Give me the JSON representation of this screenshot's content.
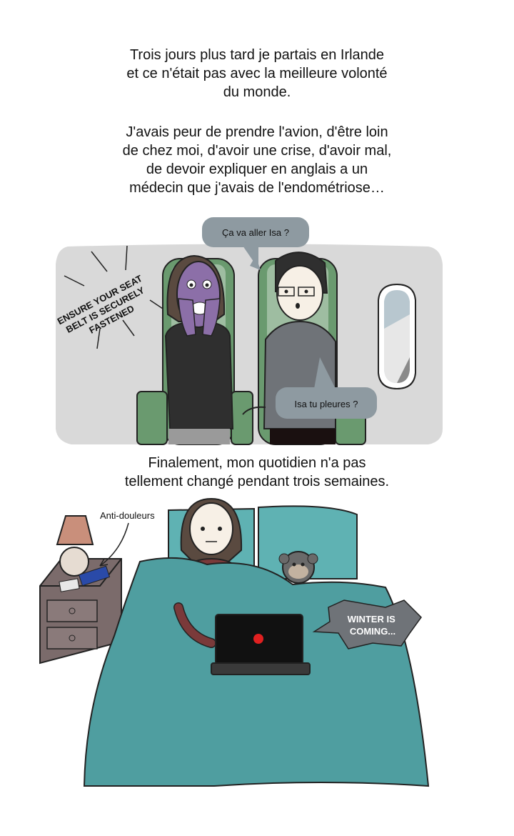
{
  "narration_1": {
    "paragraph_1": [
      "Trois jours plus tard je partais en Irlande",
      "et ce n'était pas avec la meilleure volonté",
      "du monde."
    ],
    "paragraph_2": [
      "J'avais peur de prendre l'avion, d'être loin",
      "de chez moi, d'avoir une crise, d'avoir mal,",
      "de devoir expliquer en anglais a un",
      "médecin que j'avais de l'endométriose…"
    ]
  },
  "plane_scene": {
    "seatbelt_sign": [
      "ENSURE YOUR SEAT",
      "BELT IS SECURELY",
      "FASTENED"
    ],
    "bubble_top": "Ça va aller Isa ?",
    "bubble_bottom": "Isa tu pleures ?"
  },
  "narration_2": [
    "Finalement, mon quotidien n'a pas",
    "tellement changé pendant trois semaines."
  ],
  "bed_scene": {
    "label_painkillers": "Anti-douleurs",
    "laptop_speech": [
      "WINTER IS",
      "COMING..."
    ]
  },
  "colors": {
    "plane_bg": "#d9d9d9",
    "seat_green": "#6a9a6f",
    "bubble_gray": "#8e9aa1",
    "blanket_teal": "#4f9ea0",
    "pillow_teal": "#5fb2b3",
    "nightstand": "#7b6b6b",
    "lamp_shade": "#c98f7b",
    "laptop": "#111111",
    "laptop_logo": "#e02020"
  }
}
